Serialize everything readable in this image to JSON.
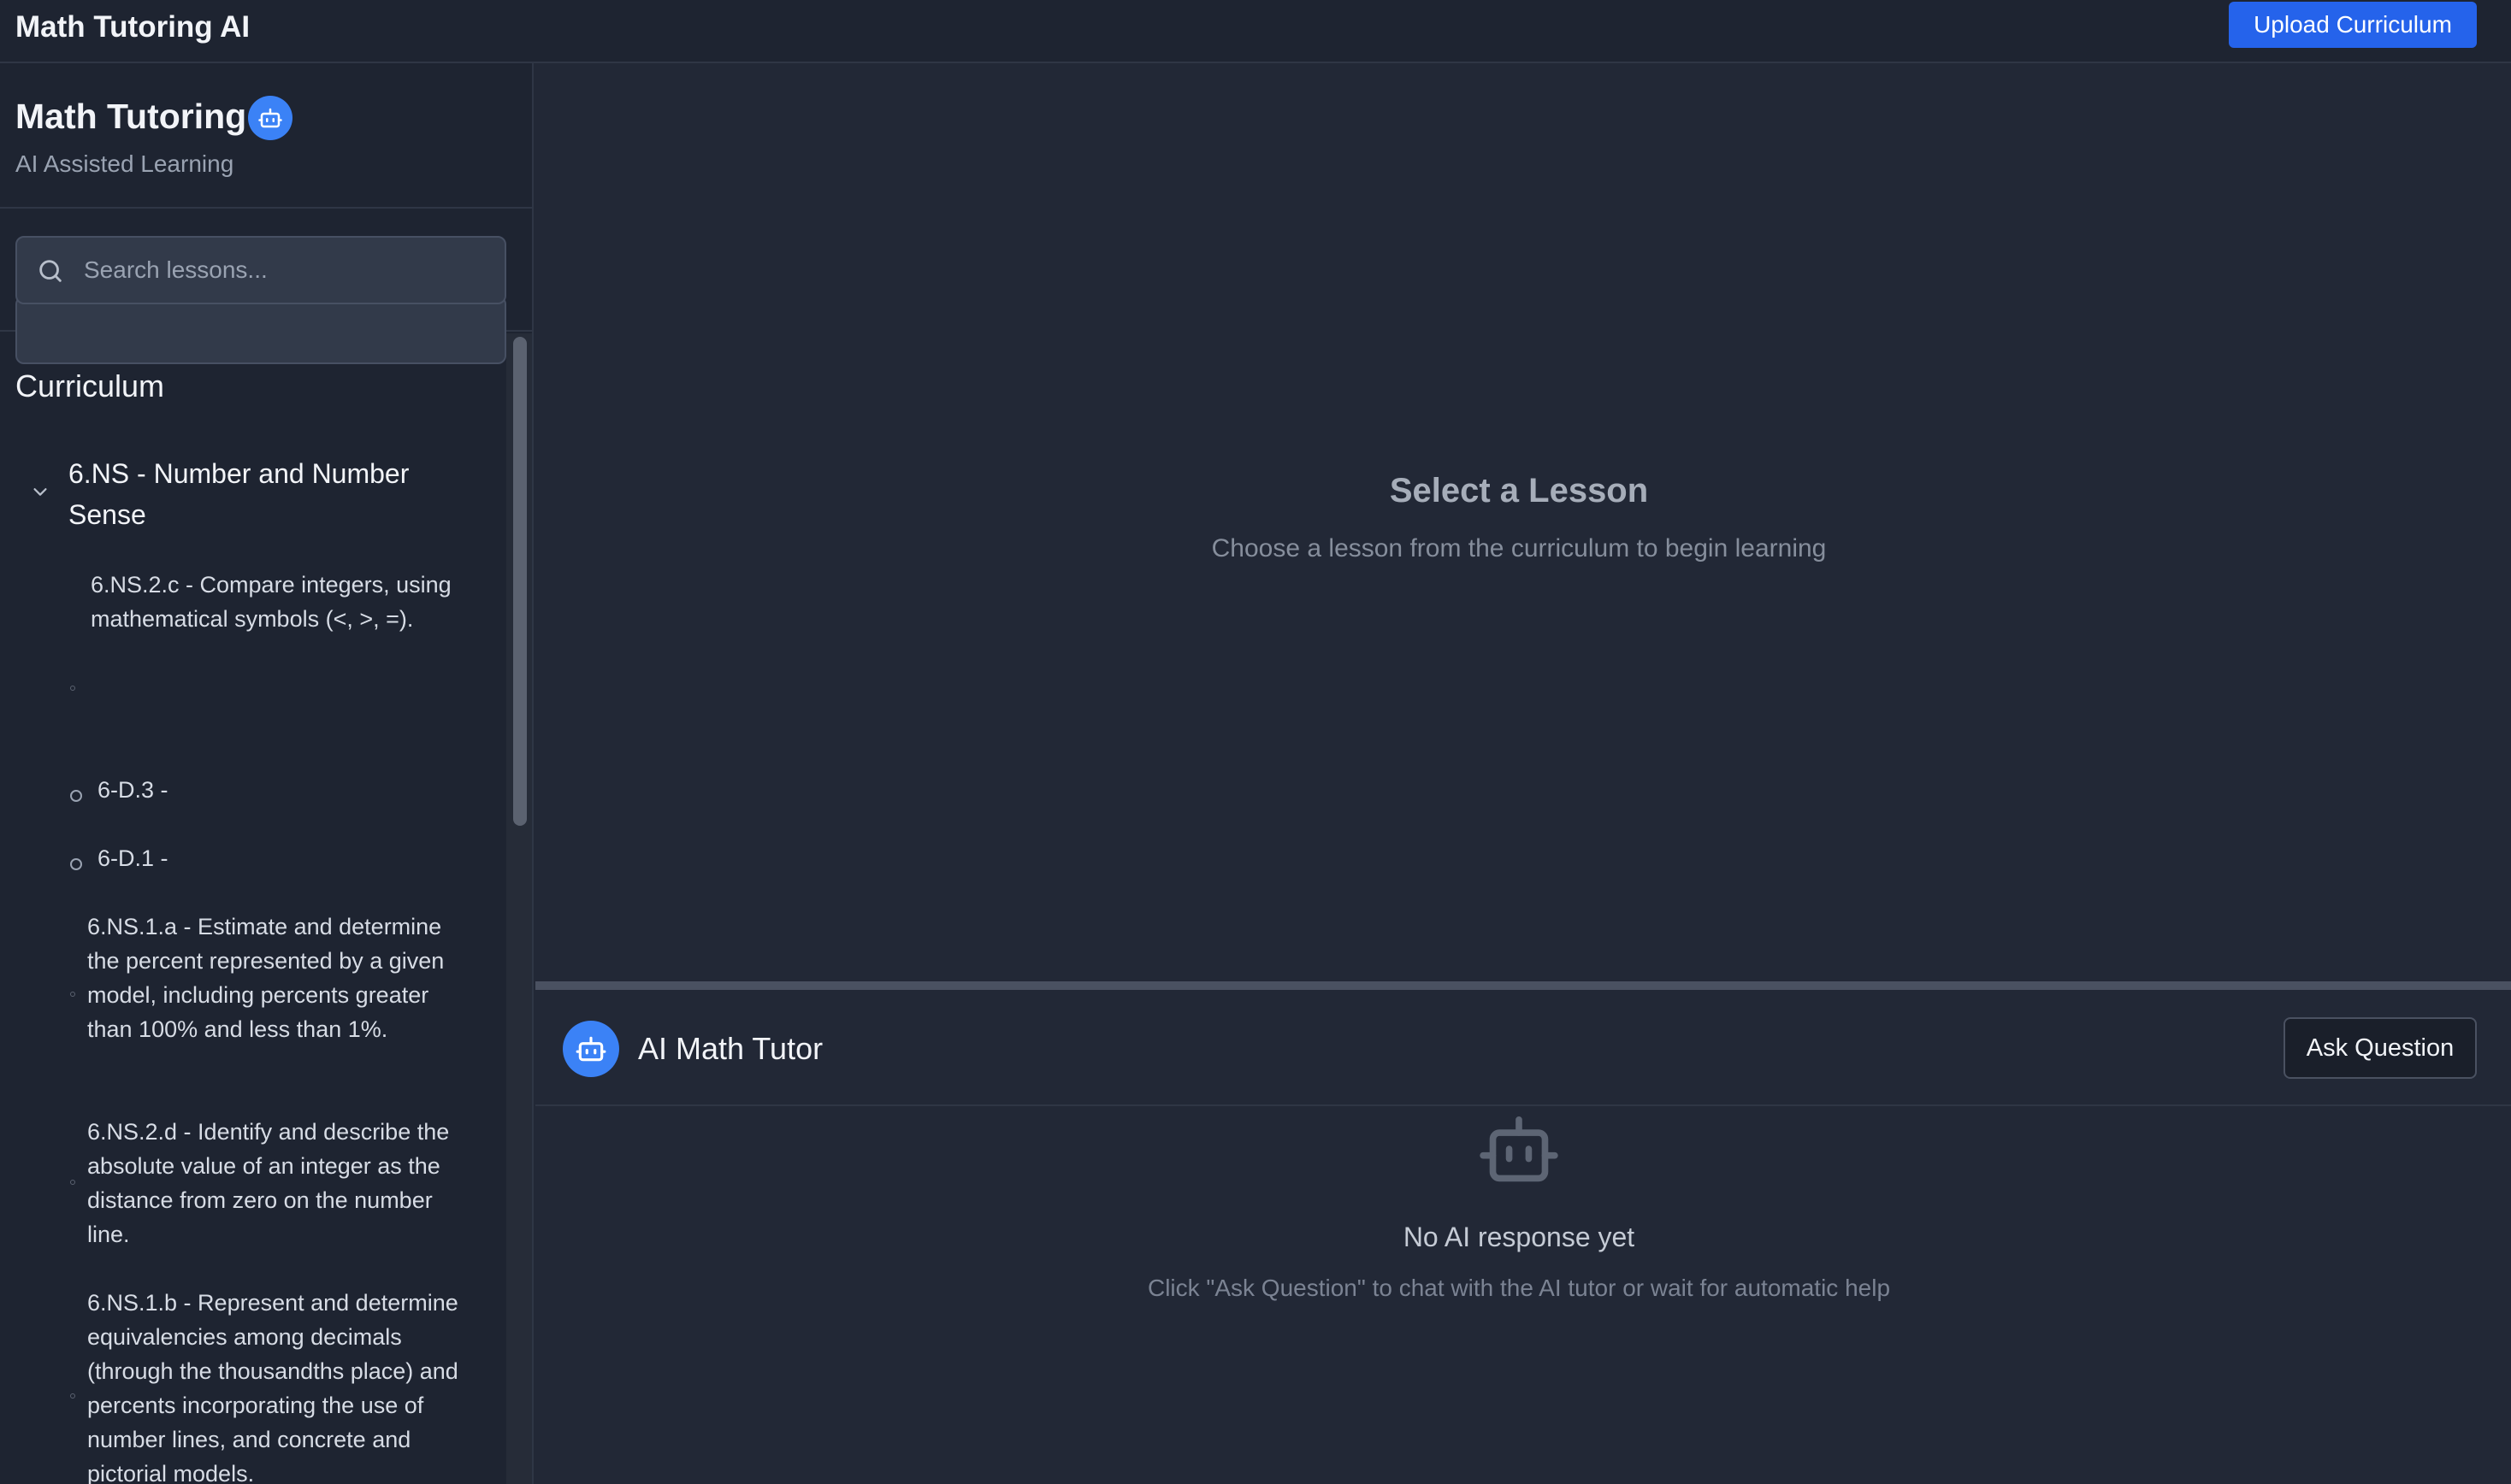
{
  "app": {
    "title": "Math Tutoring AI",
    "upload_label": "Upload Curriculum"
  },
  "sidebar": {
    "title": "Math Tutoring",
    "subtitle": "AI Assisted Learning",
    "search_placeholder": "Search lessons...",
    "curriculum_title": "Curriculum",
    "section": {
      "label": "6.NS - Number and Number Sense",
      "lessons": [
        {
          "label": "6.NS.2.c - Compare integers, using mathematical symbols (<, >, =)."
        },
        {
          "label": "6-D.3 -"
        },
        {
          "label": "6-D.1 -"
        },
        {
          "label": "6.NS.1.a - Estimate and determine the percent represented by a given model, including percents greater than 100% and less than 1%."
        },
        {
          "label": "6.NS.2.d - Identify and describe the absolute value of an integer as the distance from zero on the number line."
        },
        {
          "label": "6.NS.1.b - Represent and determine equivalencies among decimals (through the thousandths place) and percents incorporating the use of number lines, and concrete and pictorial models."
        }
      ]
    }
  },
  "main": {
    "empty_title": "Select a Lesson",
    "empty_subtitle": "Choose a lesson from the curriculum to begin learning"
  },
  "tutor": {
    "title": "AI Math Tutor",
    "ask_label": "Ask Question",
    "empty_title": "No AI response yet",
    "empty_subtitle": "Click \"Ask Question\" to chat with the AI tutor or wait for automatic help"
  },
  "colors": {
    "accent": "#2563eb",
    "bot_badge": "#3b82f6",
    "background": "#222836",
    "sidebar": "#1e2431"
  },
  "icons": [
    "robot-icon",
    "search-icon",
    "chevron-down-icon",
    "circle-icon"
  ]
}
